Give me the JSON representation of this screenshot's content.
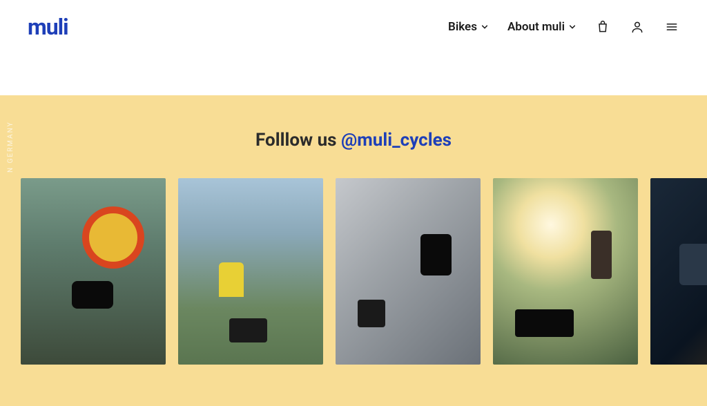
{
  "brand": "muli",
  "nav": {
    "bikes": "Bikes",
    "about": "About muli"
  },
  "follow": {
    "prefix": "Folllow us ",
    "handle": "@muli_cycles"
  },
  "side_text": "N GERMANY"
}
